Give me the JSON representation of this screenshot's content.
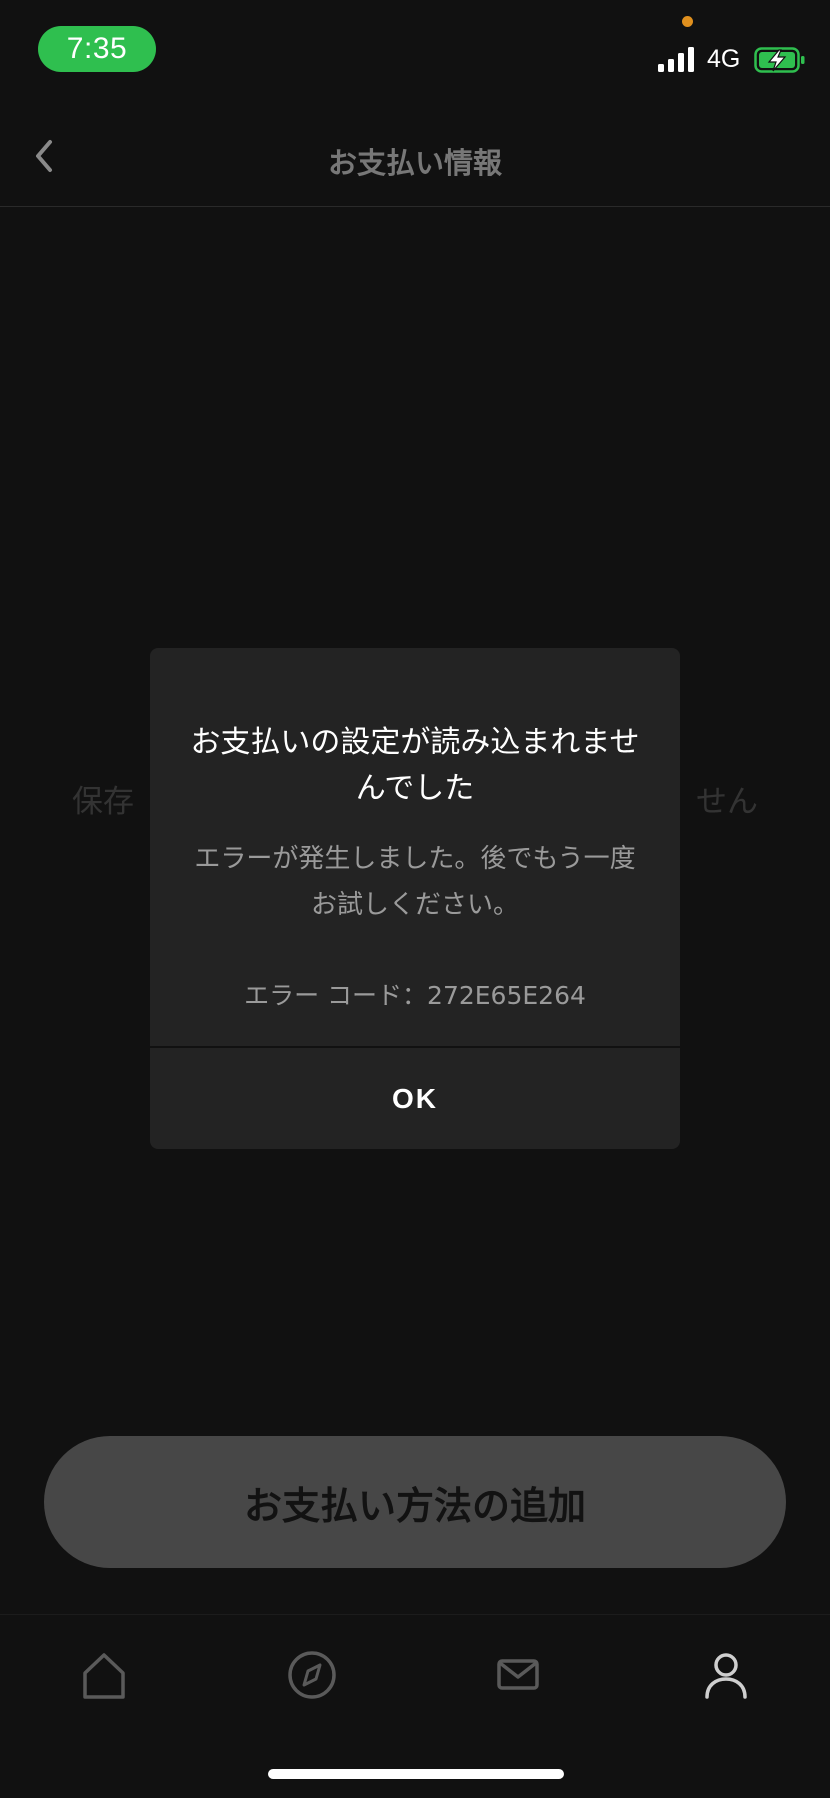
{
  "status_bar": {
    "time": "7:35",
    "network": "4G",
    "time_pill_color": "#2fbf4f",
    "battery_state": "charging"
  },
  "header": {
    "title": "お支払い情報",
    "back_icon": "chevron-left-icon"
  },
  "background": {
    "empty_message_left": "保存",
    "empty_message_right": "せん"
  },
  "dialog": {
    "title": "お支払いの設定が読み込まれませんでした",
    "message": "エラーが発生しました。後でもう一度お試しください。",
    "error_code": "エラー コード：272E65E264",
    "ok_label": "OK"
  },
  "actions": {
    "add_payment_label": "お支払い方法の追加"
  },
  "tab_bar": {
    "tabs": [
      {
        "icon": "home-icon",
        "active": false
      },
      {
        "icon": "compass-icon",
        "active": false
      },
      {
        "icon": "mail-icon",
        "active": false
      },
      {
        "icon": "profile-icon",
        "active": true
      }
    ]
  },
  "colors": {
    "background": "#111111",
    "dialog": "#232323",
    "button": "#474747",
    "active_tab": "#cfcfcf",
    "inactive_tab": "#5a5a5a"
  }
}
